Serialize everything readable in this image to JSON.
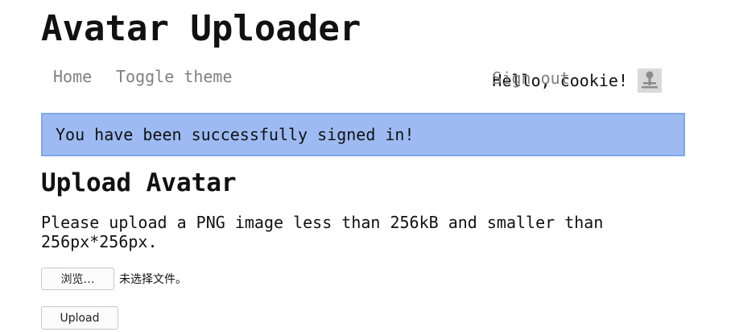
{
  "app": {
    "title": "Avatar Uploader"
  },
  "nav": {
    "home": "Home",
    "toggle_theme": "Toggle theme",
    "greeting": "Hello, cookie!",
    "sign_out": "Sign out",
    "avatar_icon": "avatar-icon"
  },
  "flash": {
    "message": "You have been successfully signed in!",
    "bg_color": "#9dbbf2"
  },
  "upload": {
    "heading": "Upload Avatar",
    "instructions": "Please upload a PNG image less than 256kB and smaller than 256px*256px.",
    "browse_label": "浏览…",
    "file_status": "未选择文件。",
    "submit_label": "Upload"
  }
}
